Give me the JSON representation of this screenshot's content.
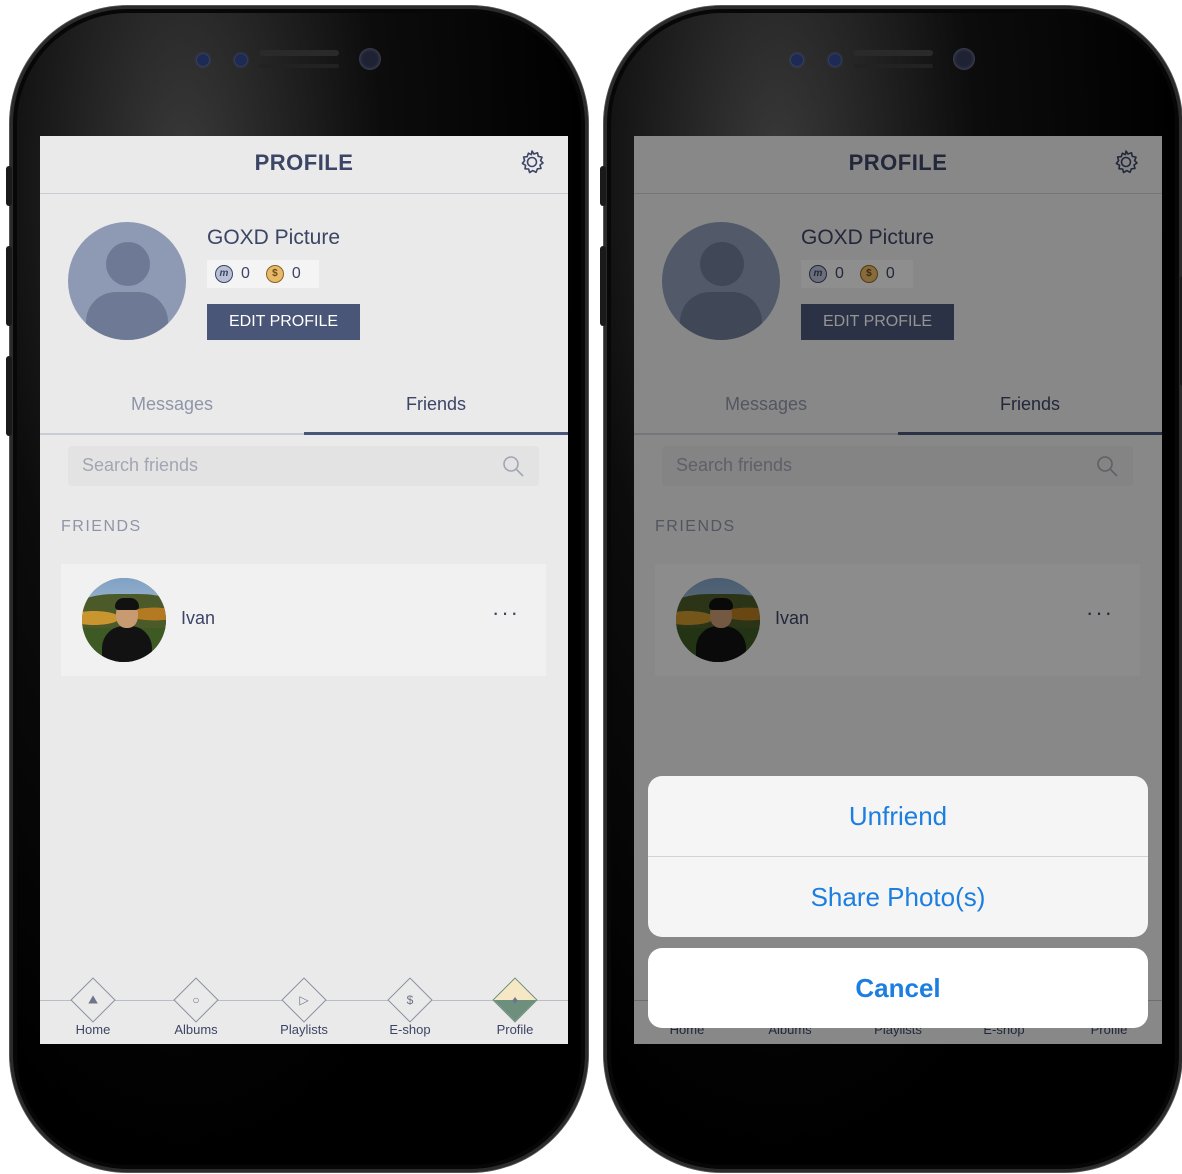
{
  "screen": {
    "title": "PROFILE",
    "profile": {
      "name": "GOXD Picture",
      "m_coin_label": "m",
      "m_coins": "0",
      "s_coin_label": "$",
      "s_coins": "0",
      "edit_label": "EDIT PROFILE"
    },
    "tabs": {
      "messages": "Messages",
      "friends": "Friends"
    },
    "search": {
      "placeholder": "Search friends"
    },
    "section_label": "FRIENDS",
    "friend": {
      "name": "Ivan",
      "more_label": "···"
    },
    "tabbar": [
      {
        "label": "Home",
        "icon": "mountain-icon"
      },
      {
        "label": "Albums",
        "icon": "album-icon"
      },
      {
        "label": "Playlists",
        "icon": "play-icon"
      },
      {
        "label": "E-shop",
        "icon": "dollar-icon"
      },
      {
        "label": "Profile",
        "icon": "profile-icon"
      }
    ]
  },
  "action_sheet": {
    "unfriend": "Unfriend",
    "share": "Share Photo(s)",
    "cancel": "Cancel"
  },
  "colors": {
    "accent": "#4a5677",
    "text": "#3c4565",
    "ios_blue": "#1c7ee0"
  }
}
